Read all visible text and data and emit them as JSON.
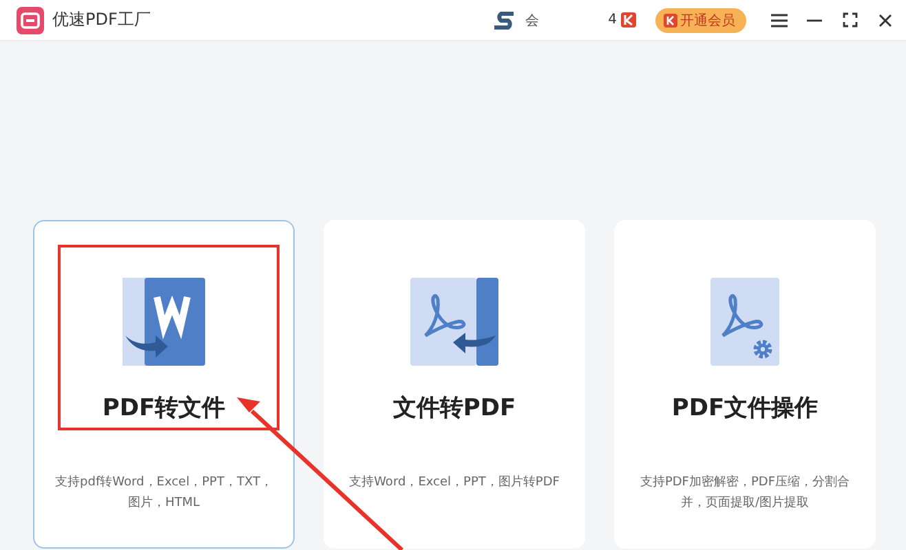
{
  "window": {
    "title": "优速PDF工厂"
  },
  "header": {
    "account": "会",
    "count": "4",
    "vip_button": "开通会员"
  },
  "cards": [
    {
      "kind": "pdf-to-file",
      "title": "PDF转文件",
      "description": "支持pdf转Word，Excel，PPT，TXT，图片，HTML",
      "selected": true
    },
    {
      "kind": "file-to-pdf",
      "title": "文件转PDF",
      "description": "支持Word，Excel，PPT，图片转PDF",
      "selected": false
    },
    {
      "kind": "pdf-tools",
      "title": "PDF文件操作",
      "description": "支持PDF加密解密，PDF压缩，分割合并，页面提取/图片提取",
      "selected": false
    }
  ]
}
